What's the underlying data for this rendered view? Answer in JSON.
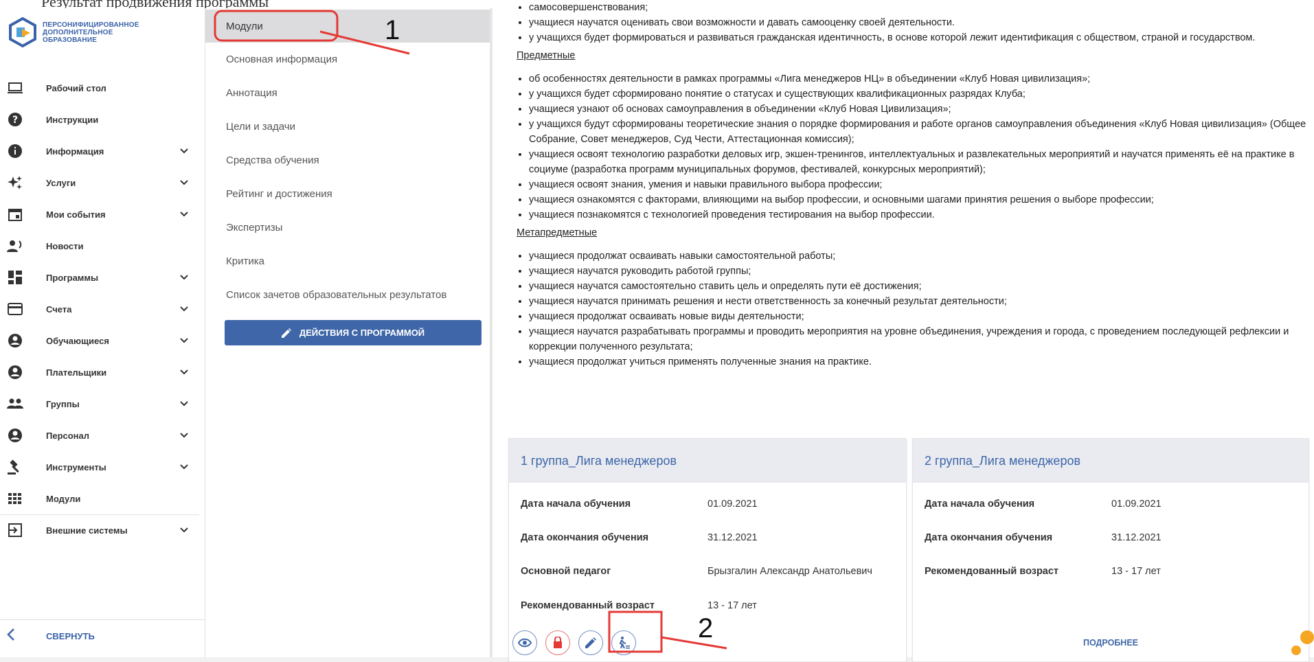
{
  "top_cut_text": "Результат продвижения программы",
  "logo": {
    "lines": [
      "ПЕРСОНИФИЦИРОВАННОЕ",
      "ДОПОЛНИТЕЛЬНОЕ",
      "ОБРАЗОВАНИЕ"
    ]
  },
  "nav": {
    "items": [
      {
        "label": "Рабочий стол",
        "icon": "laptop-icon",
        "expandable": false
      },
      {
        "label": "Инструкции",
        "icon": "help-icon",
        "expandable": false
      },
      {
        "label": "Информация",
        "icon": "info-icon",
        "expandable": true
      },
      {
        "label": "Услуги",
        "icon": "sparkle-icon",
        "expandable": true
      },
      {
        "label": "Мои события",
        "icon": "calendar-icon",
        "expandable": true
      },
      {
        "label": "Новости",
        "icon": "record-voice-icon",
        "expandable": false
      },
      {
        "label": "Программы",
        "icon": "dashboard-icon",
        "expandable": true
      },
      {
        "label": "Счета",
        "icon": "credit-card-icon",
        "expandable": true
      },
      {
        "label": "Обучающиеся",
        "icon": "account-circle-icon",
        "expandable": true
      },
      {
        "label": "Плательщики",
        "icon": "account-circle-icon",
        "expandable": true
      },
      {
        "label": "Группы",
        "icon": "group-icon",
        "expandable": true
      },
      {
        "label": "Персонал",
        "icon": "account-circle-icon",
        "expandable": true
      },
      {
        "label": "Инструменты",
        "icon": "gavel-icon",
        "expandable": true
      },
      {
        "label": "Модули",
        "icon": "apps-icon",
        "expandable": false
      },
      {
        "label": "Внешние системы",
        "icon": "login-icon",
        "expandable": true
      }
    ],
    "collapse_label": "СВЕРНУТЬ"
  },
  "menu": {
    "items": [
      "Модули",
      "Основная информация",
      "Аннотация",
      "Цели и задачи",
      "Средства обучения",
      "Рейтинг и достижения",
      "Экспертизы",
      "Критика",
      "Список зачетов образовательных результатов"
    ],
    "active_index": 0,
    "action_button": "ДЕЙСТВИЯ С ПРОГРАММОЙ"
  },
  "content": {
    "top_bullets": [
      "самосовершенствования;",
      "учащиеся научатся оценивать свои возможности и давать самооценку своей деятельности.",
      "у учащихся будет формироваться и развиваться гражданская идентичность, в основе которой лежит идентификация с обществом, страной и государством."
    ],
    "section1_title": "Предметные",
    "section1_bullets": [
      "об особенностях деятельности в рамках программы «Лига менеджеров НЦ» в объединении «Клуб Новая цивилизация»;",
      "у учащихся будет сформировано понятие о статусах и существующих квалификационных разрядах Клуба;",
      "учащиеся узнают об основах самоуправления в объединении «Клуб Новая Цивилизация»;",
      "у учащихся будут сформированы теоретические знания о порядке формирования и работе органов самоуправления объединения «Клуб Новая цивилизация» (Общее Собрание, Совет менеджеров, Суд Чести, Аттестационная комиссия);",
      "учащиеся освоят технологию разработки деловых игр, экшен-тренингов, интеллектуальных и развлекательных мероприятий и научатся применять её на практике в социуме (разработка программ муниципальных форумов, фестивалей, конкурсных мероприятий);",
      "учащиеся освоят знания, умения и навыки правильного выбора профессии;",
      "учащиеся ознакомятся с факторами, влияющими на выбор профессии, и основными шагами принятия решения о выборе профессии;",
      "учащиеся познакомятся с технологией проведения тестирования на выбор профессии."
    ],
    "section2_title": "Метапредметные",
    "section2_bullets": [
      "учащиеся продолжат осваивать навыки самостоятельной работы;",
      "учащиеся научатся руководить работой группы;",
      "учащиеся научатся самостоятельно ставить цель и определять пути её достижения;",
      "учащиеся научатся принимать решения и нести ответственность за конечный результат деятельности;",
      "учащиеся продолжат осваивать новые виды деятельности;",
      "учащиеся научатся разрабатывать программы и проводить мероприятия на уровне объединения, учреждения и города, с проведением последующей рефлексии и коррекции полученного результата;",
      "учащиеся продолжат учиться применять полученные знания на практике."
    ]
  },
  "cards": [
    {
      "title": "1 группа_Лига менеджеров",
      "rows": [
        {
          "key": "Дата начала обучения",
          "value": "01.09.2021"
        },
        {
          "key": "Дата окончания обучения",
          "value": "31.12.2021"
        },
        {
          "key": "Основной педагог",
          "value": "Брызгалин Александр Анатольевич"
        },
        {
          "key": "Рекомендованный возраст",
          "value": "13 - 17 лет"
        }
      ]
    },
    {
      "title": "2 группа_Лига менеджеров",
      "rows": [
        {
          "key": "Дата начала обучения",
          "value": "01.09.2021"
        },
        {
          "key": "Дата окончания обучения",
          "value": "31.12.2021"
        },
        {
          "key": "Рекомендованный возраст",
          "value": "13 - 17 лет"
        }
      ],
      "more_label": "ПОДРОБНЕЕ"
    }
  ],
  "annotations": {
    "label1": "1",
    "label2": "2",
    "color": "#e53935"
  },
  "colors": {
    "accent": "#3e66a8",
    "card_header": "#e9ebf1",
    "danger": "#e57373"
  }
}
